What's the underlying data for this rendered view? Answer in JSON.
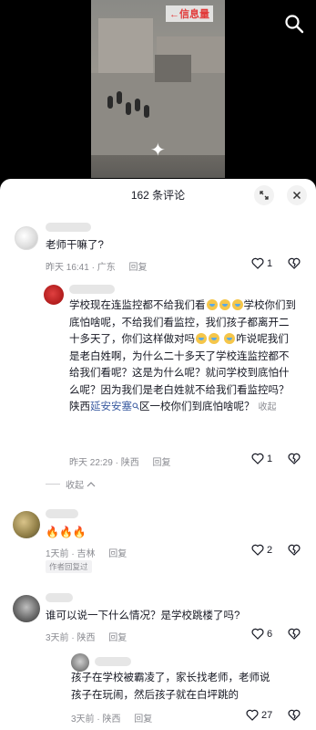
{
  "video": {
    "overlay_text": "←信息量"
  },
  "panel": {
    "comment_count": "162 条评论"
  },
  "comments": [
    {
      "text": "老师干嘛了?",
      "time_loc": "昨天 16:41 · 广东",
      "reply": "回复",
      "likes": "1"
    },
    {
      "text_parts": {
        "a": "学校现在连监控都不给我们看",
        "b": "学校你们到底怕啥呢，不给我们看监控，我们孩子都离开二十多天了，你们这样做对吗",
        "c": "咋说呢我们是老白姓啊，为什么二十多天了学校连监控都不给我们看呢？这是为什么呢？就问学校到底怕什么呢？因为我们是老白姓就不给我们看监控吗？陕西",
        "link": "延安安塞",
        "d": "区一校你们到底怕啥呢？",
        "fold": "收起"
      },
      "time_loc": "昨天 22:29 · 陕西",
      "reply": "回复",
      "likes": "1"
    },
    {
      "collapse_label": "收起"
    },
    {
      "text": "🔥🔥🔥",
      "time_loc": "1天前 · 吉林",
      "reply": "回复",
      "likes": "2",
      "tag": "作者回复过"
    },
    {
      "text": "谁可以说一下什么情况？是学校跳楼了吗?",
      "time_loc": "3天前 · 陕西",
      "reply": "回复",
      "likes": "6"
    },
    {
      "text": "孩子在学校被霸凌了，家长找老师，老师说孩子在玩闹，然后孩子就在白坪跳的",
      "time_loc": "3天前 · 陕西",
      "reply": "回复",
      "likes": "27"
    }
  ],
  "colors": {
    "link": "#3a5ba0",
    "meta": "#8a8b91",
    "text": "#161823"
  }
}
